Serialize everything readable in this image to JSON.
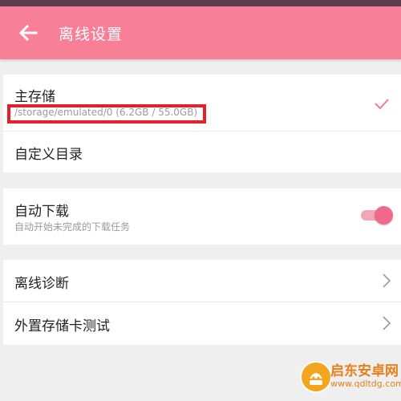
{
  "status_bar": {
    "text": ""
  },
  "app_bar": {
    "title": "离线设置",
    "back_icon": "arrow-left-icon"
  },
  "storage": {
    "primary_label": "主存储",
    "primary_path": "/storage/emulated/0 (6.2GB / 55.0GB)",
    "selected": true,
    "custom_dir_label": "自定义目录"
  },
  "auto_download": {
    "label": "自动下载",
    "description": "自动开始未完成的下载任务",
    "enabled": true
  },
  "diagnostics": {
    "items": [
      {
        "label": "离线诊断"
      },
      {
        "label": "外置存储卡测试"
      }
    ]
  },
  "watermark": {
    "brand": "启东安卓网",
    "url": "www.qdltdg.com"
  },
  "colors": {
    "accent": "#f77f98",
    "toggle_thumb": "#f0698a",
    "highlight_box": "#e5202a",
    "background": "#efefef"
  }
}
